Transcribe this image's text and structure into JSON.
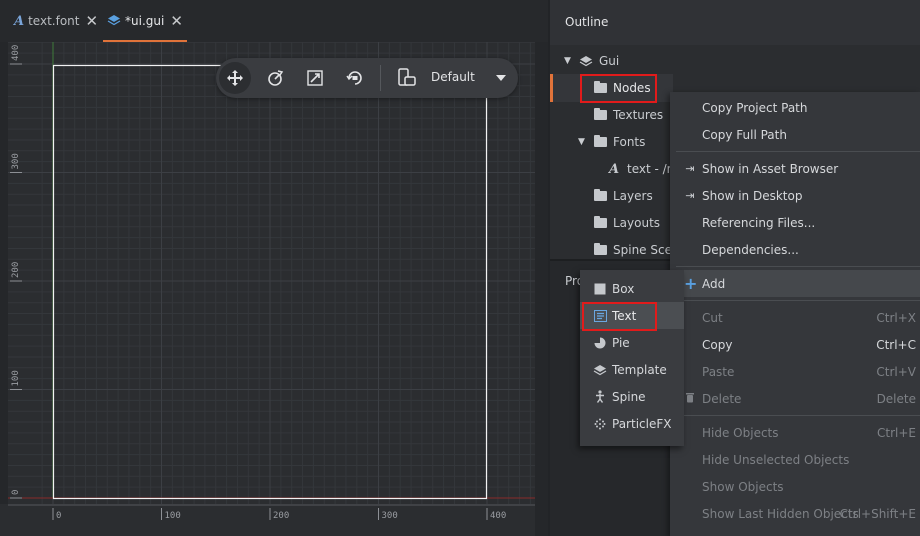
{
  "tabs": [
    {
      "icon": "font-file-icon",
      "label": "text.font",
      "active": false
    },
    {
      "icon": "gui-file-icon",
      "label": "*ui.gui",
      "active": true
    }
  ],
  "toolbar": {
    "tools": [
      "move-tool-icon",
      "rotate-tool-icon",
      "scale-tool-icon",
      "camera-reset-icon"
    ],
    "layout_label": "Default"
  },
  "canvas": {
    "x_ticks": [
      "0",
      "100",
      "200",
      "300",
      "400"
    ],
    "y_ticks": [
      "0",
      "100",
      "200",
      "300",
      "400"
    ]
  },
  "outline": {
    "title": "Outline",
    "root": "Gui",
    "items": [
      {
        "label": "Nodes",
        "selected": true
      },
      {
        "label": "Textures"
      },
      {
        "label": "Fonts",
        "expanded": true
      },
      {
        "label": "text - /m",
        "child": true
      },
      {
        "label": "Layers"
      },
      {
        "label": "Layouts"
      },
      {
        "label": "Spine Scen"
      }
    ]
  },
  "properties": {
    "title": "Pro"
  },
  "context_menu": {
    "items": [
      {
        "label": "Copy Project Path",
        "enabled": true
      },
      {
        "label": "Copy Full Path",
        "enabled": true
      },
      {
        "label": "Show in Asset Browser",
        "enabled": true,
        "icon": "reveal-icon"
      },
      {
        "label": "Show in Desktop",
        "enabled": true,
        "icon": "reveal-icon"
      },
      {
        "label": "Referencing Files...",
        "enabled": true
      },
      {
        "label": "Dependencies...",
        "enabled": true
      },
      {
        "label": "Add",
        "enabled": true,
        "icon": "plus-icon",
        "has_submenu": true
      },
      {
        "label": "Cut",
        "shortcut": "Ctrl+X",
        "enabled": false
      },
      {
        "label": "Copy",
        "shortcut": "Ctrl+C",
        "enabled": true
      },
      {
        "label": "Paste",
        "shortcut": "Ctrl+V",
        "enabled": false
      },
      {
        "label": "Delete",
        "shortcut": "Delete",
        "enabled": false,
        "icon": "trash-icon"
      },
      {
        "label": "Hide Objects",
        "shortcut": "Ctrl+E",
        "enabled": false
      },
      {
        "label": "Hide Unselected Objects",
        "enabled": false
      },
      {
        "label": "Show Objects",
        "enabled": false
      },
      {
        "label": "Show Last Hidden Objects",
        "shortcut": "Ctrl+Shift+E",
        "enabled": false
      }
    ]
  },
  "add_submenu": {
    "items": [
      {
        "label": "Box",
        "icon": "box-icon"
      },
      {
        "label": "Text",
        "icon": "text-node-icon",
        "highlighted": true
      },
      {
        "label": "Pie",
        "icon": "pie-icon"
      },
      {
        "label": "Template",
        "icon": "template-icon"
      },
      {
        "label": "Spine",
        "icon": "spine-icon"
      },
      {
        "label": "ParticleFX",
        "icon": "particlefx-icon"
      }
    ]
  },
  "colors": {
    "accent": "#e0733a",
    "highlight_box": "#e11b1b",
    "canvas_bg": "#2b2d30",
    "menu_bg": "#35373b"
  }
}
